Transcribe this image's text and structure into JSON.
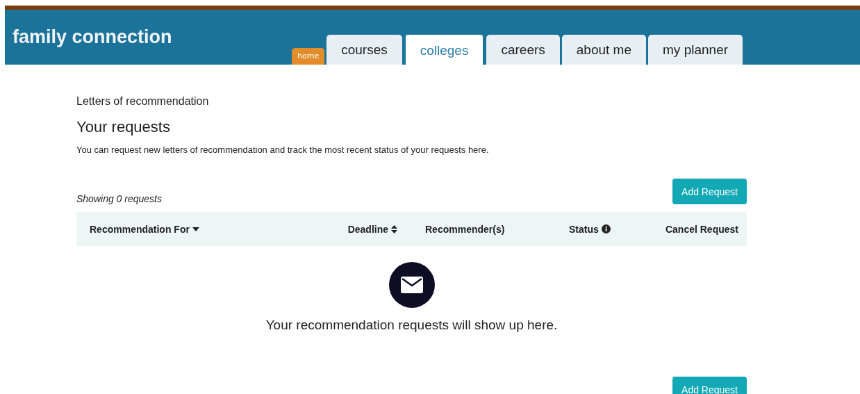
{
  "header": {
    "brand": "family connection",
    "home_tab": {
      "label": "home",
      "selected": false
    },
    "tabs": [
      {
        "label": "courses",
        "selected": false
      },
      {
        "label": "colleges",
        "selected": true
      },
      {
        "label": "careers",
        "selected": false
      },
      {
        "label": "about me",
        "selected": false
      },
      {
        "label": "my planner",
        "selected": false
      }
    ]
  },
  "breadcrumb": "Letters of recommendation",
  "title": "Your requests",
  "description": "You can request new letters of recommendation and track the most recent status of your requests here.",
  "count": "Showing 0 requests",
  "add_button": "Add Request",
  "table": {
    "columns": [
      {
        "label": "Recommendation For",
        "kind": "caret"
      },
      {
        "label": "Deadline",
        "kind": "sort"
      },
      {
        "label": "Recommender(s)",
        "kind": "plain"
      },
      {
        "label": "Status",
        "kind": "info"
      },
      {
        "label": "Cancel Request",
        "kind": "plain"
      }
    ]
  },
  "empty_message": "Your recommendation requests will show up here.",
  "bottom_button": "Add Request"
}
